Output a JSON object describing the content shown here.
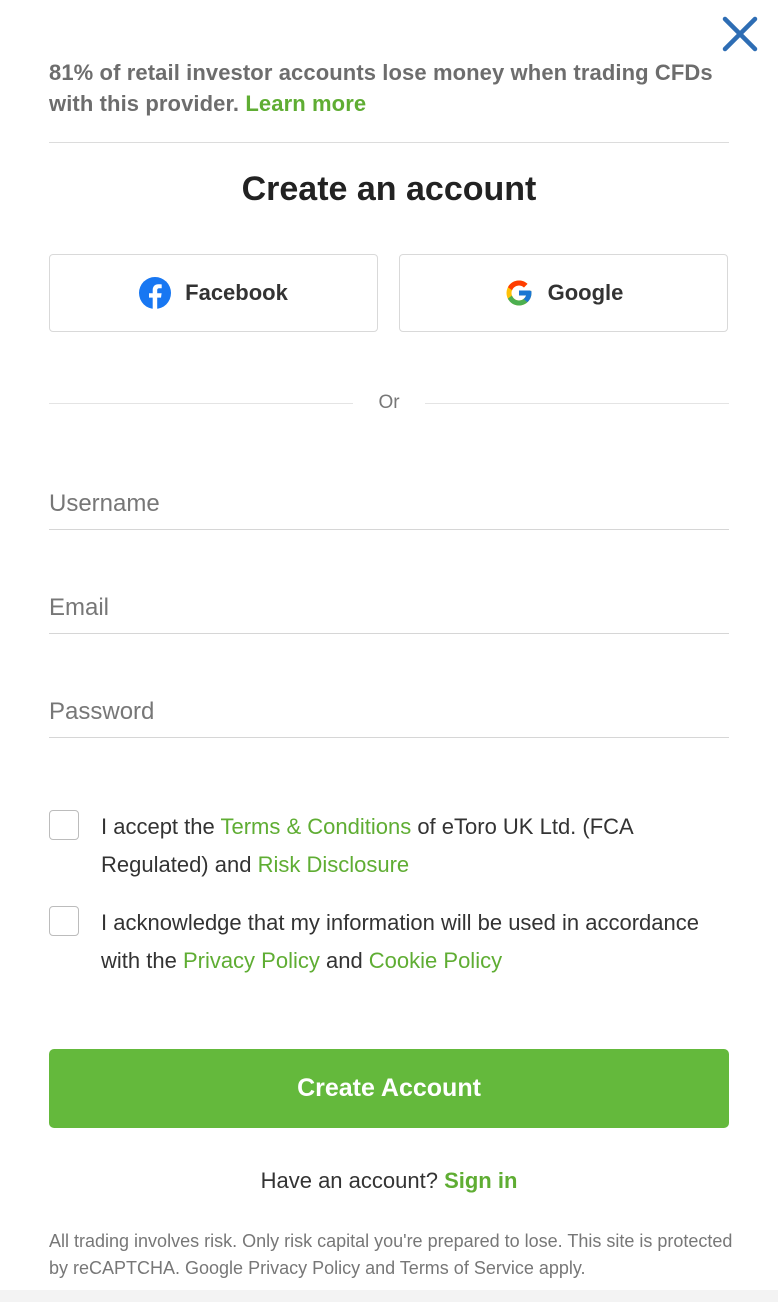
{
  "banner": {
    "text": "81% of retail investor accounts lose money when trading CFDs with this provider.",
    "link": "Learn more"
  },
  "title": "Create an account",
  "social": {
    "facebook": "Facebook",
    "google": "Google"
  },
  "or_text": "Or",
  "fields": {
    "username_placeholder": "Username",
    "email_placeholder": "Email",
    "password_placeholder": "Password"
  },
  "terms": {
    "part1": "I accept the ",
    "terms_link": "Terms & Conditions",
    "part2": " of eToro UK Ltd. (FCA Regulated) and ",
    "risk_link": "Risk Disclosure"
  },
  "privacy": {
    "part1": "I acknowledge that my information will be used in accordance with the ",
    "privacy_link": "Privacy Policy",
    "part2": " and ",
    "cookie_link": "Cookie Policy"
  },
  "create_button": "Create Account",
  "signin": {
    "prompt": "Have an account? ",
    "link": "Sign in"
  },
  "footer": "All trading involves risk. Only risk capital you're prepared to lose. This site is protected by reCAPTCHA. Google Privacy Policy and Terms of Service apply.",
  "colors": {
    "accent_green": "#64b93c",
    "link_green": "#5fad33",
    "close_blue": "#2e6db4",
    "facebook_blue": "#1877f2"
  },
  "icons": {
    "close": "close-icon",
    "facebook": "facebook-icon",
    "google": "google-icon"
  }
}
